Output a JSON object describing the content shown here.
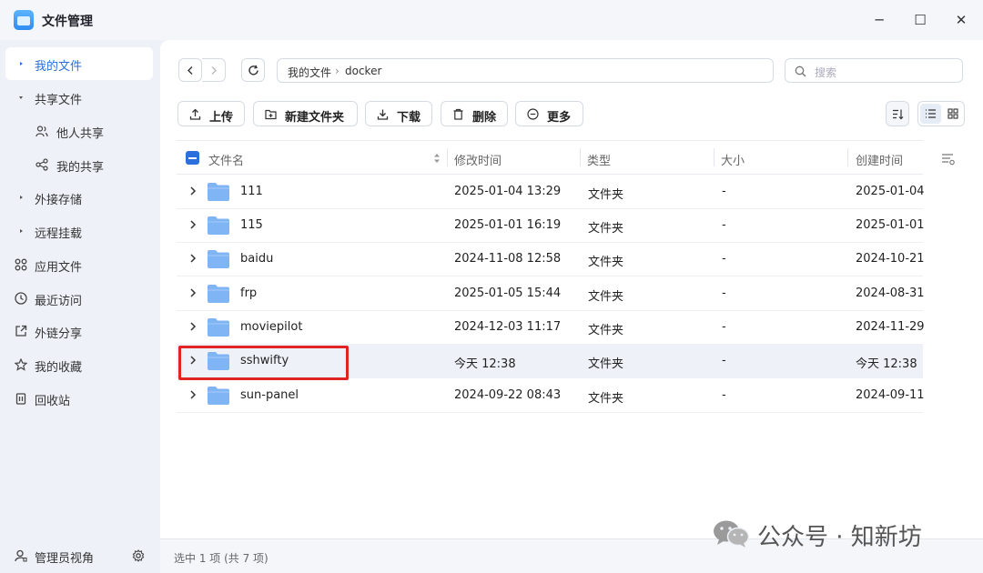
{
  "app": {
    "title": "文件管理"
  },
  "window_controls": {
    "minimize": "─",
    "maximize": "☐",
    "close": "✕"
  },
  "sidebar": {
    "items": [
      {
        "label": "我的文件",
        "icon": "caret-right-icon",
        "active": true
      },
      {
        "label": "共享文件",
        "icon": "caret-down-icon"
      },
      {
        "label": "他人共享",
        "icon": "users-icon",
        "sub": true
      },
      {
        "label": "我的共享",
        "icon": "share-icon",
        "sub": true
      },
      {
        "label": "外接存储",
        "icon": "caret-right-icon"
      },
      {
        "label": "远程挂载",
        "icon": "caret-right-icon"
      },
      {
        "label": "应用文件",
        "icon": "apps-grid-icon"
      },
      {
        "label": "最近访问",
        "icon": "clock-icon"
      },
      {
        "label": "外链分享",
        "icon": "external-link-icon"
      },
      {
        "label": "我的收藏",
        "icon": "star-icon"
      },
      {
        "label": "回收站",
        "icon": "trash-icon"
      }
    ],
    "footer": {
      "label": "管理员视角",
      "icon": "admin-user-icon",
      "settings_icon": "gear-icon"
    }
  },
  "breadcrumb": {
    "root": "我的文件",
    "separator": "›",
    "current": "docker"
  },
  "search": {
    "placeholder": "搜索"
  },
  "toolbar": {
    "upload": "上传",
    "new_folder": "新建文件夹",
    "download": "下载",
    "delete": "删除",
    "more": "更多"
  },
  "table": {
    "headers": {
      "name": "文件名",
      "modified": "修改时间",
      "type": "类型",
      "size": "大小",
      "created": "创建时间"
    },
    "rows": [
      {
        "name": "111",
        "modified": "2025-01-04 13:29",
        "type": "文件夹",
        "size": "-",
        "created": "2025-01-04"
      },
      {
        "name": "115",
        "modified": "2025-01-01 16:19",
        "type": "文件夹",
        "size": "-",
        "created": "2025-01-01"
      },
      {
        "name": "baidu",
        "modified": "2024-11-08 12:58",
        "type": "文件夹",
        "size": "-",
        "created": "2024-10-21"
      },
      {
        "name": "frp",
        "modified": "2025-01-05 15:44",
        "type": "文件夹",
        "size": "-",
        "created": "2024-08-31"
      },
      {
        "name": "moviepilot",
        "modified": "2024-12-03 11:17",
        "type": "文件夹",
        "size": "-",
        "created": "2024-11-29"
      },
      {
        "name": "sshwifty",
        "modified": "今天 12:38",
        "type": "文件夹",
        "size": "-",
        "created": "今天 12:38",
        "selected": true
      },
      {
        "name": "sun-panel",
        "modified": "2024-09-22 08:43",
        "type": "文件夹",
        "size": "-",
        "created": "2024-09-11"
      }
    ]
  },
  "status": {
    "text": "选中 1 项 (共 7 项)"
  },
  "watermark": {
    "text": "公众号 · 知新坊"
  },
  "colors": {
    "accent": "#2a6fdb",
    "folder": "#7fb4f5",
    "highlight": "#e02424"
  }
}
